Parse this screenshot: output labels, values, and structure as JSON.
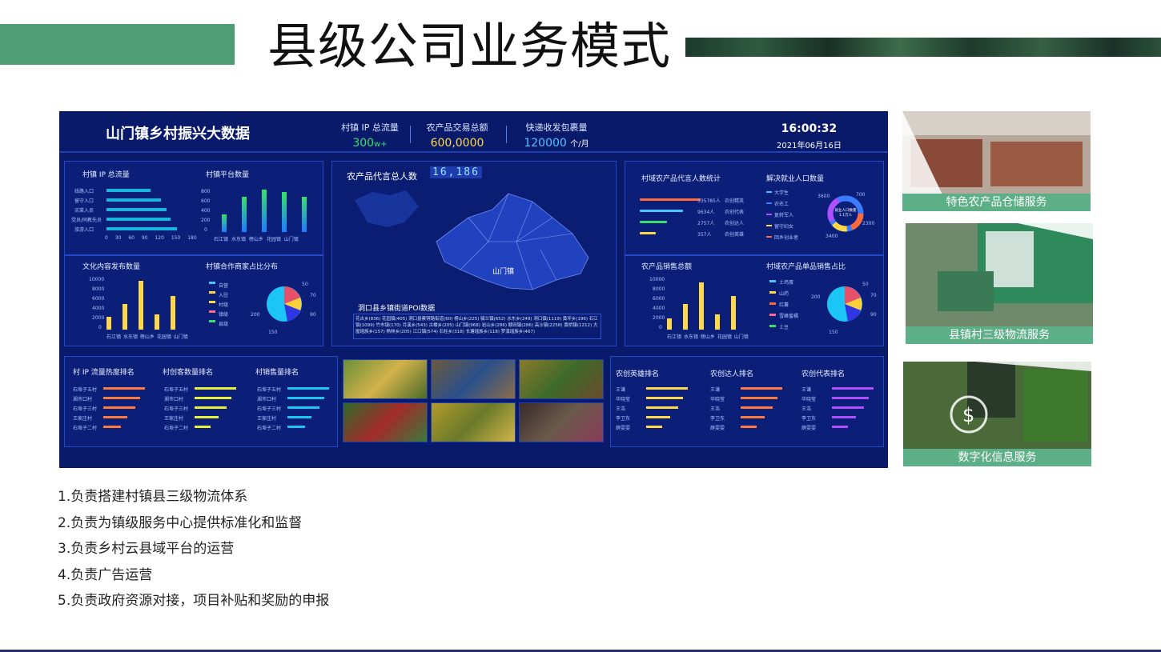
{
  "page": {
    "title": "县级公司业务模式"
  },
  "dashboard": {
    "title": "山门镇乡村振兴大数据",
    "stats": [
      {
        "label": "村镇 IP 总流量",
        "value": "300",
        "unit": "w+",
        "color": "#39e06a"
      },
      {
        "label": "农产品交易总额",
        "value": "600,0000",
        "unit": "",
        "color": "#ffd84a"
      },
      {
        "label": "快递收发包裹量",
        "value": "120000",
        "unit": "个/月",
        "color": "#4fc3ff"
      }
    ],
    "time": "16:00:32",
    "date": "2021年06月16日",
    "panels": {
      "ip_total": {
        "title": "村镇 IP 总流量",
        "rows": [
          "线路入口",
          "留守入口",
          "买菜入员",
          "党员/同教先员",
          "旅游入口"
        ],
        "values": [
          110,
          135,
          150,
          160,
          175
        ],
        "axis": [
          "0",
          "30",
          "60",
          "90",
          "120",
          "150",
          "180"
        ]
      },
      "platform_count": {
        "title": "村镇平台数量",
        "categories": [
          "石江镇",
          "水东镇",
          "榜山乡",
          "花园镇",
          "山门镇"
        ],
        "values": [
          350,
          700,
          850,
          800,
          700
        ],
        "yticks": [
          "800",
          "600",
          "400",
          "200",
          "0"
        ]
      },
      "culture": {
        "title": "文化内容发布数量",
        "categories": [
          "石江镇",
          "水东镇",
          "榜山乡",
          "花园镇",
          "山门镇"
        ],
        "values": [
          2500,
          5200,
          9800,
          3000,
          6800
        ],
        "yticks": [
          "10000",
          "8000",
          "6000",
          "4000",
          "2000",
          "0"
        ]
      },
      "merchant": {
        "title": "村镇合作商家占比分布",
        "legend": [
          "自营",
          "入驻",
          "村级",
          "镇级",
          "县级"
        ],
        "values": [
          "50",
          "70",
          "90",
          "150",
          "200"
        ]
      },
      "map": {
        "title": "农产品代言总人数",
        "count": "16,186",
        "town": "山门镇",
        "poi_title": "洞口县乡镇街道POI数据",
        "poi_text": "花古乡(836) 花园镇(405) 洞口县蔡锷路街道(60) 榜山乡(225) 毓兰镇(652) 水东乡(249) 洞口镇(1119) 黄坪乡(196) 石江镇(1099) 竹市镇(170) 月溪乡(543) 古楼乡(205) 山门镇(968) 岩山乡(286) 醪田镇(286) 高沙镇(2258) 黄桥镇(1212) 大屋瑶族乡(157) 杨林乡(205) 江口镇(574) 石柱乡(318) 长塘瑶族乡(118) 罗溪瑶族乡(467)"
      },
      "spokesperson": {
        "title": "村域农产品代言人数统计",
        "rows": [
          {
            "value": "335785人",
            "label": "农创精英",
            "color": "#ff6a3d"
          },
          {
            "value": "9634人",
            "label": "农创代表",
            "color": "#4fc3ff"
          },
          {
            "value": "2757人",
            "label": "农创达人",
            "color": "#39e06a"
          },
          {
            "value": "357人",
            "label": "农创英雄",
            "color": "#ffd84a"
          }
        ]
      },
      "employment": {
        "title": "解决就业人口数量",
        "legend": [
          "大学生",
          "农名工",
          "复转军人",
          "留守妇女",
          "回乡创业者"
        ],
        "center": "就业人口数量",
        "center_value": "1.1万人",
        "labels": [
          "700",
          "3600",
          "2300",
          "3400"
        ]
      },
      "sales": {
        "title": "农产品销售总额",
        "categories": [
          "石江镇",
          "水东镇",
          "榜山乡",
          "花园镇",
          "山门镇"
        ],
        "values": [
          2200,
          5200,
          9500,
          3000,
          6800
        ],
        "yticks": [
          "10000",
          "8000",
          "6000",
          "4000",
          "2000",
          "0"
        ]
      },
      "single": {
        "title": "村域农产品单品销售占比",
        "legend": [
          "土鸡蛋",
          "山药",
          "红薯",
          "雪峰蜜橘",
          "土豆"
        ],
        "values": [
          "50",
          "70",
          "90",
          "150",
          "200"
        ]
      },
      "rank_ip": {
        "title": "村 IP 流量热度排名",
        "rows": [
          "石埠子五村",
          "湘市口村",
          "石埠子三村",
          "王家庄村",
          "石埠子二村"
        ]
      },
      "rank_visit": {
        "title": "村创客数量排名",
        "rows": [
          "石埠子五村",
          "湘市口村",
          "石埠子三村",
          "王家庄村",
          "石埠子二村"
        ]
      },
      "rank_sales": {
        "title": "村销售量排名",
        "rows": [
          "石埠子五村",
          "湘市口村",
          "石埠子三村",
          "王家庄村",
          "石埠子二村"
        ]
      },
      "rank_hero": {
        "title": "农创英雄排名",
        "rows": [
          "王谦",
          "毕晓莹",
          "王浩",
          "李卫东",
          "薛雯雯"
        ]
      },
      "rank_talent": {
        "title": "农创达人排名",
        "rows": [
          "王谦",
          "毕晓莹",
          "王浩",
          "李卫东",
          "薛雯雯"
        ]
      },
      "rank_rep": {
        "title": "农创代表排名",
        "rows": [
          "王谦",
          "毕晓莹",
          "王浩",
          "李卫东",
          "薛雯雯"
        ]
      }
    }
  },
  "services": [
    {
      "label": "特色农产品仓储服务"
    },
    {
      "label": "县镇村三级物流服务"
    },
    {
      "label": "数字化信息服务"
    }
  ],
  "responsibilities": [
    "1.负责搭建村镇县三级物流体系",
    "2.负责为镇级服务中心提供标准化和监督",
    "3.负责乡村云县域平台的运营",
    "4.负责广告运营",
    "5.负责政府资源对接，项目补贴和奖励的申报"
  ],
  "colors": {
    "accent_green": "#4f9d72",
    "caption_green": "#5caf87",
    "dash_bg": "#0a1a6b"
  }
}
